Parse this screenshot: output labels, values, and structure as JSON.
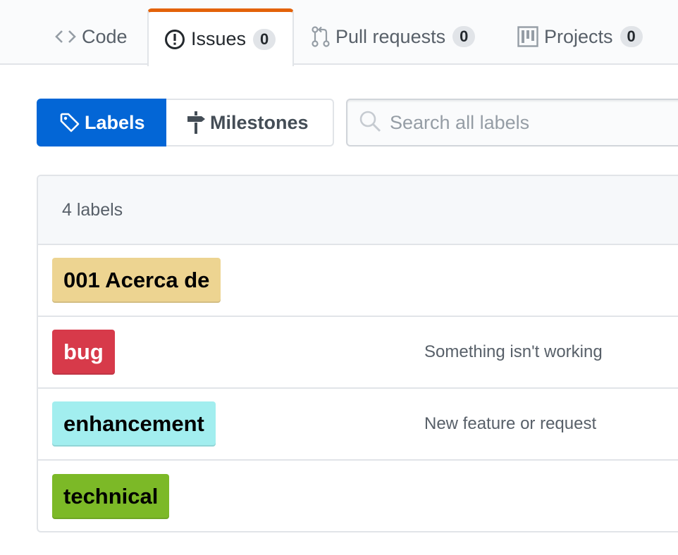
{
  "reponav": {
    "tabs": [
      {
        "label": "Code",
        "icon": "code-icon"
      },
      {
        "label": "Issues",
        "count": "0",
        "icon": "issue-opened-icon"
      },
      {
        "label": "Pull requests",
        "count": "0",
        "icon": "git-pull-request-icon"
      },
      {
        "label": "Projects",
        "count": "0",
        "icon": "project-icon"
      }
    ],
    "selected_tab": "Issues",
    "selected_accent": "#e36209"
  },
  "subnav": {
    "labels_link": "Labels",
    "milestones_link": "Milestones",
    "selected": "Labels",
    "selected_color": "#0366d6"
  },
  "search": {
    "placeholder": "Search all labels",
    "value": ""
  },
  "labels_box": {
    "count_text": "4 labels",
    "labels": [
      {
        "name": "001 Acerca de",
        "description": "",
        "color": "#edd491",
        "text_color": "#000000"
      },
      {
        "name": "bug",
        "description": "Something isn't working",
        "color": "#d73a4a",
        "text_color": "#ffffff"
      },
      {
        "name": "enhancement",
        "description": "New feature or request",
        "color": "#a2eeef",
        "text_color": "#000000"
      },
      {
        "name": "technical",
        "description": "",
        "color": "#7cb927",
        "text_color": "#000000"
      }
    ]
  }
}
